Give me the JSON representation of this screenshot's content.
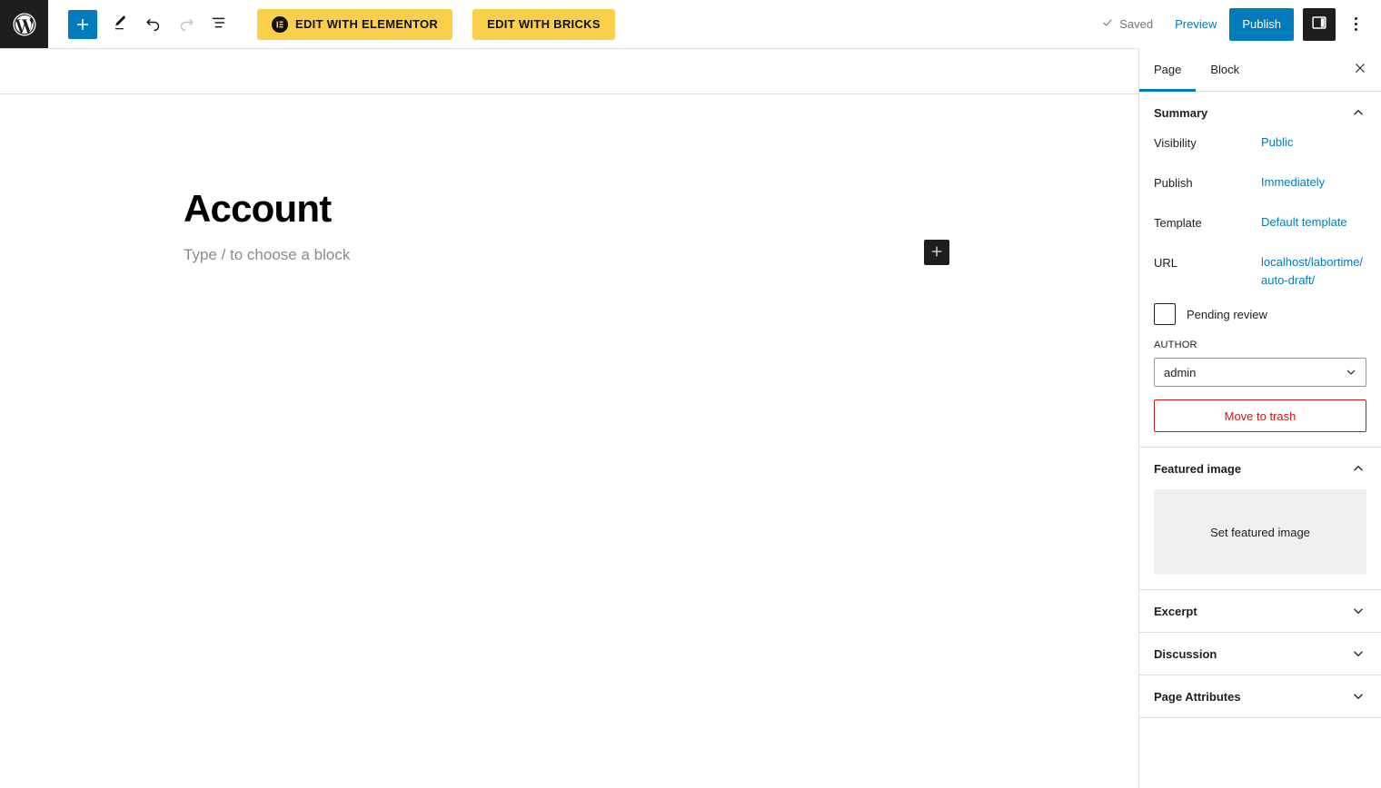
{
  "toolbar": {
    "wp_logo": "wordpress-logo",
    "add_block_label": "+",
    "tools_icon": "pencil-icon",
    "undo_icon": "undo-icon",
    "redo_icon": "redo-icon",
    "list_view_icon": "list-view-icon",
    "elementor_button": "EDIT WITH ELEMENTOR",
    "bricks_button": "EDIT WITH BRICKS",
    "saved_label": "Saved",
    "preview_label": "Preview",
    "publish_label": "Publish",
    "sidebar_toggle_icon": "sidebar-panel-icon",
    "more_options_icon": "three-dots-icon",
    "accent_blue": "#007cba",
    "yellow": "#f9cf4c",
    "dark": "#1e1e1e"
  },
  "editor": {
    "post_title": "Account",
    "block_placeholder": "Type / to choose a block",
    "inserter_label": "+"
  },
  "sidebar": {
    "tabs": [
      {
        "label": "Page",
        "active": true
      },
      {
        "label": "Block",
        "active": false
      }
    ],
    "close_label": "×",
    "summary": {
      "title": "Summary",
      "expanded": true,
      "rows": [
        {
          "label": "Visibility",
          "value": "Public"
        },
        {
          "label": "Publish",
          "value": "Immediately"
        },
        {
          "label": "Template",
          "value": "Default template"
        },
        {
          "label": "URL",
          "value": "localhost/labortime/auto-draft/"
        }
      ],
      "pending_review_label": "Pending review",
      "pending_review_checked": false,
      "author_label": "AUTHOR",
      "author_value": "admin",
      "trash_label": "Move to trash",
      "trash_color": "#cc1818"
    },
    "featured_image": {
      "title": "Featured image",
      "expanded": true,
      "set_label": "Set featured image"
    },
    "collapsed_panels": [
      {
        "title": "Excerpt"
      },
      {
        "title": "Discussion"
      },
      {
        "title": "Page Attributes"
      }
    ]
  }
}
